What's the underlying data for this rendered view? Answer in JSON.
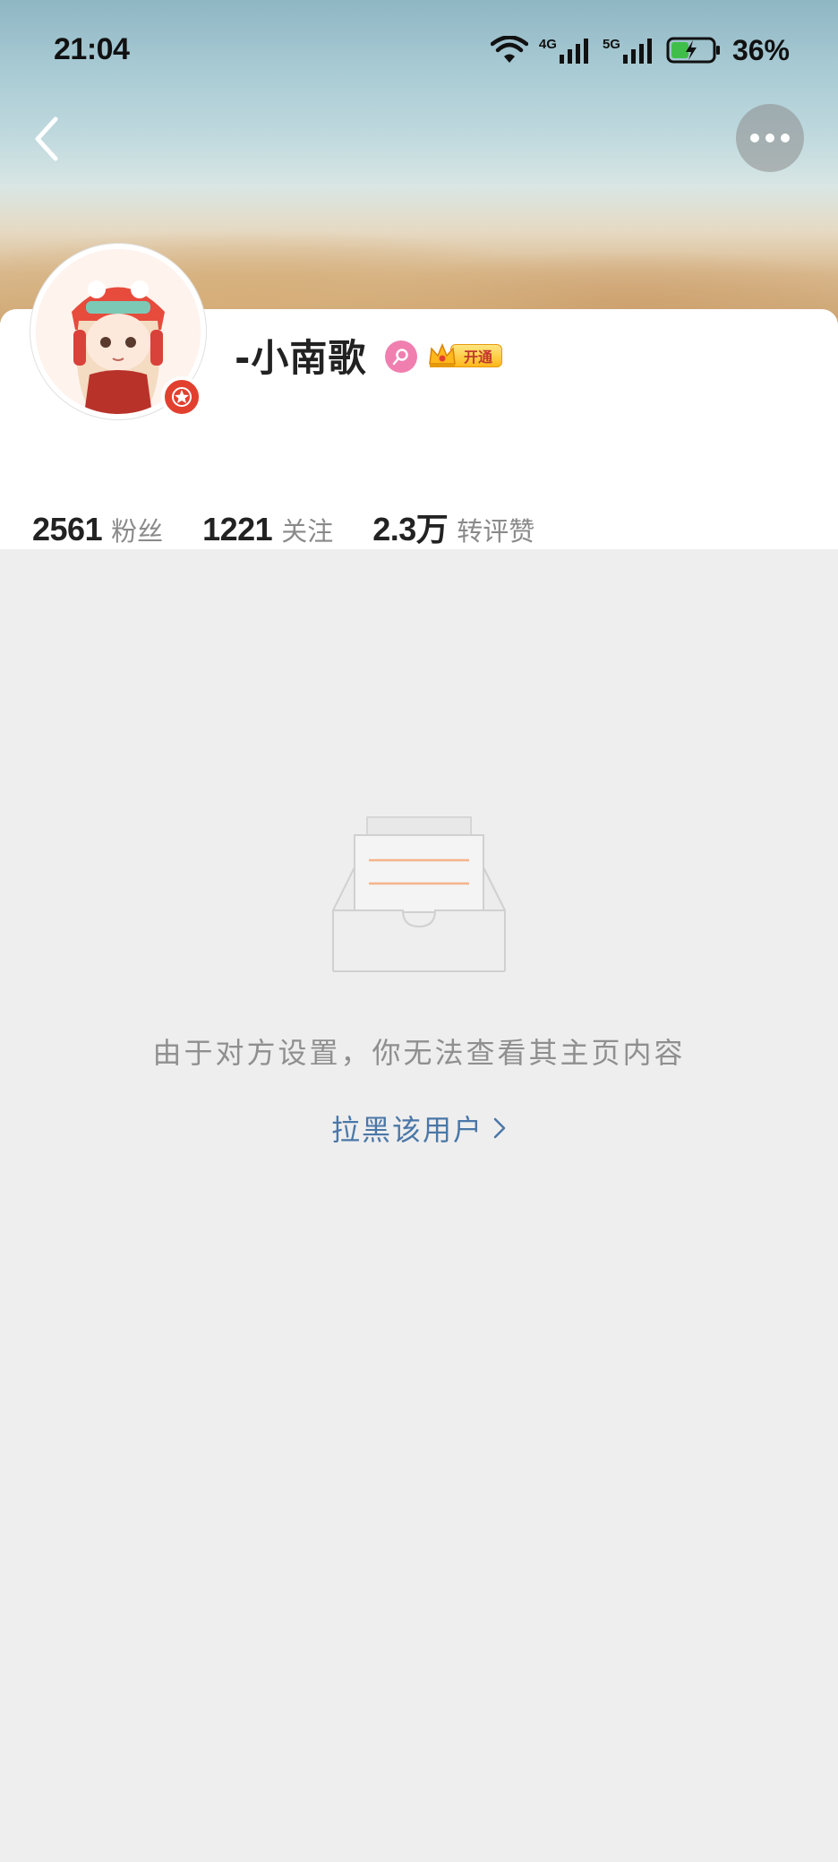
{
  "status_bar": {
    "time": "21:04",
    "network_1": "4G",
    "network_2": "5G",
    "battery": "36%"
  },
  "nav": {
    "back_icon": "chevron-left-icon",
    "more_icon": "more-dots-icon"
  },
  "profile": {
    "username": "-小南歌",
    "gender_icon": "female-icon",
    "vip_label": "开通",
    "stats": [
      {
        "value": "2561",
        "label": "粉丝"
      },
      {
        "value": "1221",
        "label": "关注"
      },
      {
        "value": "2.3万",
        "label": "转评赞"
      }
    ]
  },
  "empty_state": {
    "message": "由于对方设置，你无法查看其主页内容",
    "action_label": "拉黑该用户"
  },
  "colors": {
    "link": "#4a77a8",
    "badge_red": "#e2402f",
    "gender_pink": "#f07fb0",
    "vip_gold": "#ffb81c"
  }
}
